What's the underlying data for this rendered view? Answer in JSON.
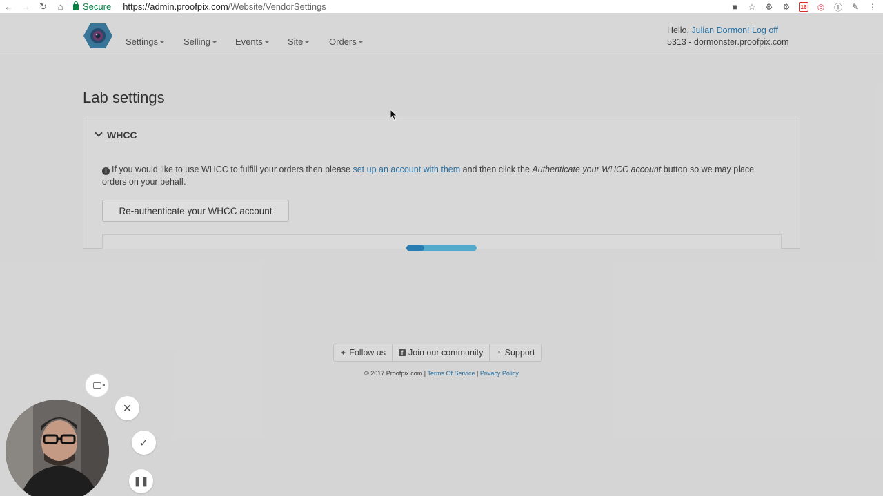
{
  "browser": {
    "secure_label": "Secure",
    "url_host": "https://admin.proofpix.com",
    "url_path": "/Website/VendorSettings",
    "extension_badge": "16"
  },
  "nav": {
    "menu": [
      {
        "label": "Settings"
      },
      {
        "label": "Selling"
      },
      {
        "label": "Events"
      },
      {
        "label": "Site"
      },
      {
        "label": "Orders"
      }
    ],
    "greeting": "Hello,",
    "user_name": "Julian Dormon!",
    "logoff": "Log off",
    "account_line": "5313 - dormonster.proofpix.com"
  },
  "page": {
    "title": "Lab settings"
  },
  "whcc_panel": {
    "heading": "WHCC",
    "info_pre": "If you would like to use WHCC to fulfill your orders then please",
    "info_link": "set up an account with them",
    "info_mid": "and then click the",
    "info_em": "Authenticate your WHCC account",
    "info_post": "button so we may place orders on your behalf.",
    "reauth_button": "Re-authenticate your WHCC account"
  },
  "loading": {
    "progress_fraction": 0.25
  },
  "footer": {
    "follow_us": "Follow us",
    "join_community": "Join our community",
    "support": "Support",
    "copyright": "© 2017 Proofpix.com |",
    "terms": "Terms Of Service",
    "divider": "|",
    "privacy": "Privacy Policy"
  },
  "colors": {
    "link": "#2a7ab0",
    "progress_track": "#5ab9dc",
    "progress_fill": "#2d86bd",
    "secure_green": "#0b8043"
  }
}
